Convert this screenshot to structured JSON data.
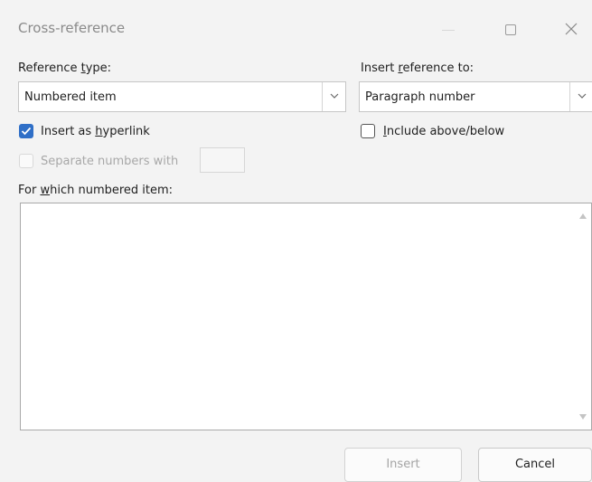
{
  "dialog": {
    "title": "Cross-reference",
    "icons": {
      "minimize": "minimize-icon",
      "maximize": "maximize-icon",
      "close": "close-icon"
    }
  },
  "reference_type": {
    "label_pre": "Reference ",
    "label_key": "t",
    "label_post": "ype:",
    "value": "Numbered item"
  },
  "insert_reference_to": {
    "label_pre": "Insert ",
    "label_key": "r",
    "label_post": "eference to:",
    "value": "Paragraph number"
  },
  "insert_as_hyperlink": {
    "label_pre": "Insert as ",
    "label_key": "h",
    "label_post": "yperlink",
    "checked": true
  },
  "include_above_below": {
    "label_pre": "",
    "label_key": "I",
    "label_post": "nclude above/below",
    "checked": false
  },
  "separate_numbers": {
    "label": "Separate numbers with",
    "checked": false,
    "enabled": false,
    "value": ""
  },
  "for_which": {
    "label_pre": "For ",
    "label_key": "w",
    "label_post": "hich numbered item:",
    "items": []
  },
  "buttons": {
    "insert": "Insert",
    "cancel": "Cancel"
  },
  "colors": {
    "accent": "#2f6fc7",
    "background": "#f3f3f3"
  }
}
